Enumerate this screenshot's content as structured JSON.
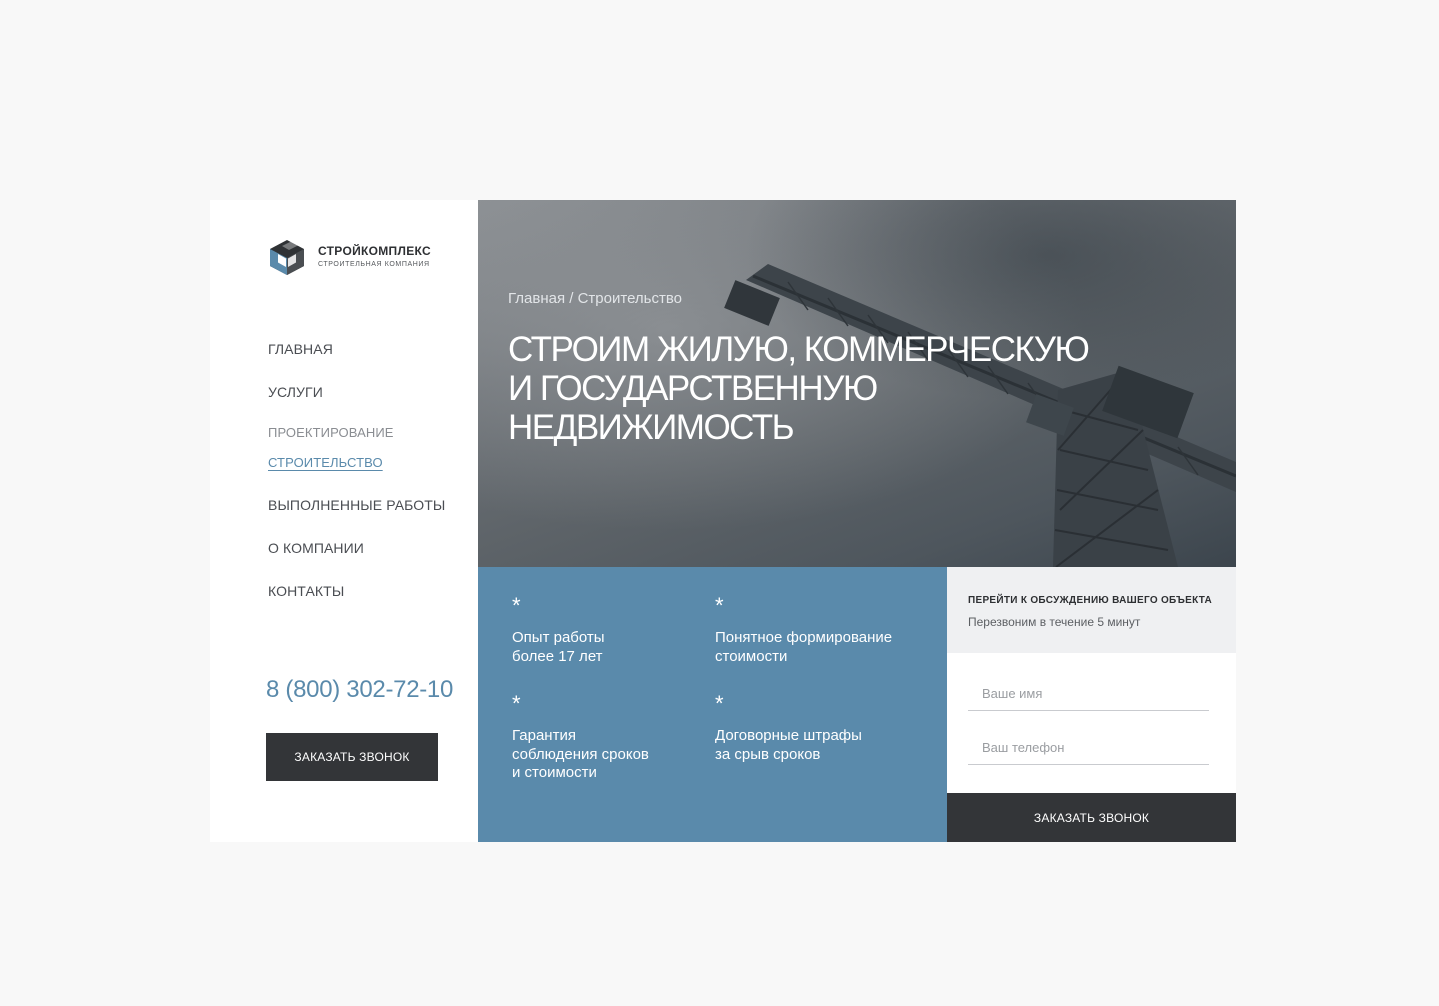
{
  "brand": {
    "name": "СТРОЙКОМПЛЕКС",
    "tagline": "СТРОИТЕЛЬНАЯ КОМПАНИЯ",
    "logo_icon": "building-blocks-logo",
    "colors": {
      "accent": "#5a8aab",
      "dark": "#333538",
      "background": "#f8f8f8"
    }
  },
  "nav": {
    "items": [
      {
        "label": "ГЛАВНАЯ",
        "state": "normal"
      },
      {
        "label": "УСЛУГИ",
        "state": "normal"
      },
      {
        "label": "ПРОЕКТИРОВАНИЕ",
        "state": "sub"
      },
      {
        "label": "СТРОИТЕЛЬСТВО",
        "state": "active"
      },
      {
        "label": "ВЫПОЛНЕННЫЕ РАБОТЫ",
        "state": "normal"
      },
      {
        "label": "О КОМПАНИИ",
        "state": "normal"
      },
      {
        "label": "КОНТАКТЫ",
        "state": "normal"
      }
    ]
  },
  "contact": {
    "phone": "8 (800) 302-72-10",
    "callback_label": "ЗАКАЗАТЬ ЗВОНОК"
  },
  "hero": {
    "breadcrumb": "Главная / Строительство",
    "title": "СТРОИМ ЖИЛУЮ, КОММЕРЧЕСКУЮ\nИ ГОСУДАРСТВЕННУЮ\nНЕДВИЖИМОСТЬ",
    "image": "construction-crane-photo"
  },
  "features": {
    "items": [
      {
        "star": "*",
        "text": "Опыт работы\nболее 17 лет"
      },
      {
        "star": "*",
        "text": "Понятное формирование\nстоимости"
      },
      {
        "star": "*",
        "text": "Гарантия\nсоблюдения сроков\nи стоимости"
      },
      {
        "star": "*",
        "text": "Договорные штрафы\nза срыв сроков"
      }
    ]
  },
  "form": {
    "title": "ПЕРЕЙТИ К ОБСУЖДЕНИЮ ВАШЕГО ОБЪЕКТА",
    "subtitle": "Перезвоним в течение 5 минут",
    "name_placeholder": "Ваше имя",
    "phone_placeholder": "Ваш телефон",
    "submit_label": "ЗАКАЗАТЬ ЗВОНОК"
  }
}
